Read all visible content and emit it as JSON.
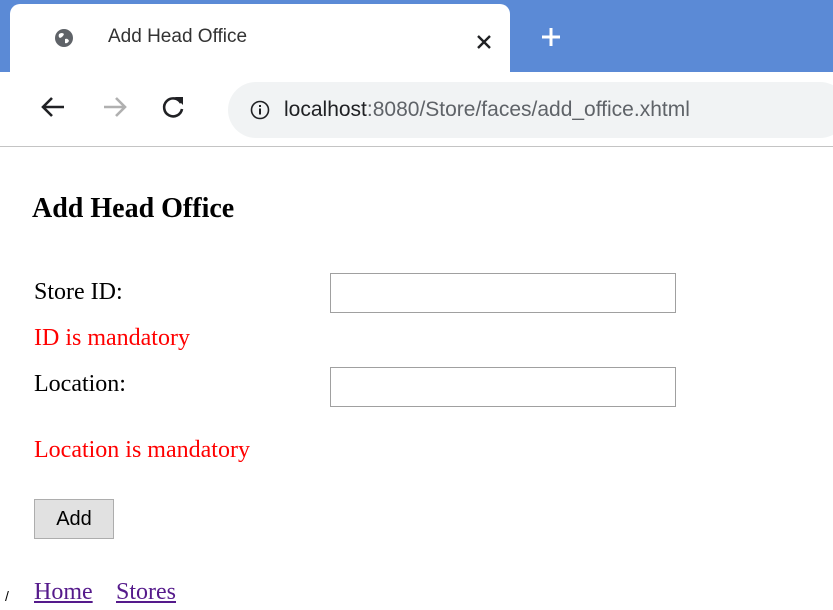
{
  "browser": {
    "tab_title": "Add Head Office",
    "url_host": "localhost",
    "url_path": ":8080/Store/faces/add_office.xhtml"
  },
  "page": {
    "title": "Add Head Office",
    "store_id_label": "Store ID:",
    "store_id_value": "",
    "store_id_error": "ID is mandatory",
    "location_label": "Location:",
    "location_value": "",
    "location_error": "Location is mandatory",
    "add_button": "Add"
  },
  "footer": {
    "separator": "/",
    "home_link": "Home",
    "stores_link": "Stores"
  },
  "colors": {
    "tab_strip": "#5b8ad6",
    "error_text": "#ff0000",
    "visited_link": "#551a8b"
  }
}
